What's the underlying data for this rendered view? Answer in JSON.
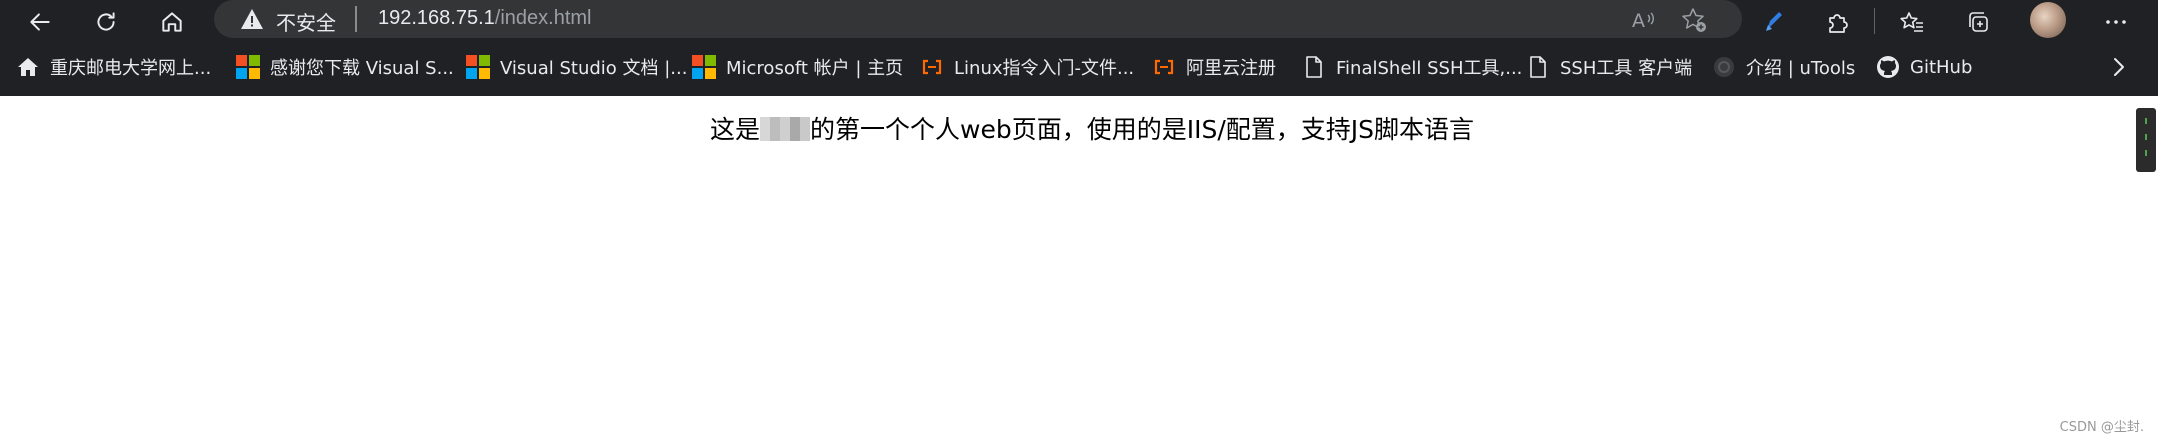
{
  "address_bar": {
    "security_label": "不安全",
    "url_host": "192.168.75.1",
    "url_path": "/index.html"
  },
  "bookmarks": [
    {
      "label": "重庆邮电大学网上...",
      "icon": "home-icon"
    },
    {
      "label": "感谢您下载 Visual S...",
      "icon": "microsoft-logo-icon"
    },
    {
      "label": "Visual Studio 文档 |...",
      "icon": "microsoft-logo-icon"
    },
    {
      "label": "Microsoft 帐户 | 主页",
      "icon": "microsoft-logo-icon"
    },
    {
      "label": "Linux指令入门-文件...",
      "icon": "aliyun-icon"
    },
    {
      "label": "阿里云注册",
      "icon": "aliyun-icon"
    },
    {
      "label": "FinalShell SSH工具,...",
      "icon": "page-icon"
    },
    {
      "label": "SSH工具 客户端",
      "icon": "page-icon"
    },
    {
      "label": "介绍 | uTools",
      "icon": "utools-icon"
    },
    {
      "label": "GitHub",
      "icon": "github-icon"
    }
  ],
  "page": {
    "text_before": "这是",
    "text_after": "的第一个个人web页面，使用的是IIS/配置，支持JS脚本语言"
  },
  "watermark": "CSDN @尘封.",
  "colors": {
    "chrome_bg": "#202124",
    "address_bg": "#343537",
    "microsoft_red": "#f25022",
    "microsoft_green": "#7fba00",
    "microsoft_blue": "#00a4ef",
    "microsoft_yellow": "#ffb900",
    "aliyun_orange": "#ff6a00"
  }
}
